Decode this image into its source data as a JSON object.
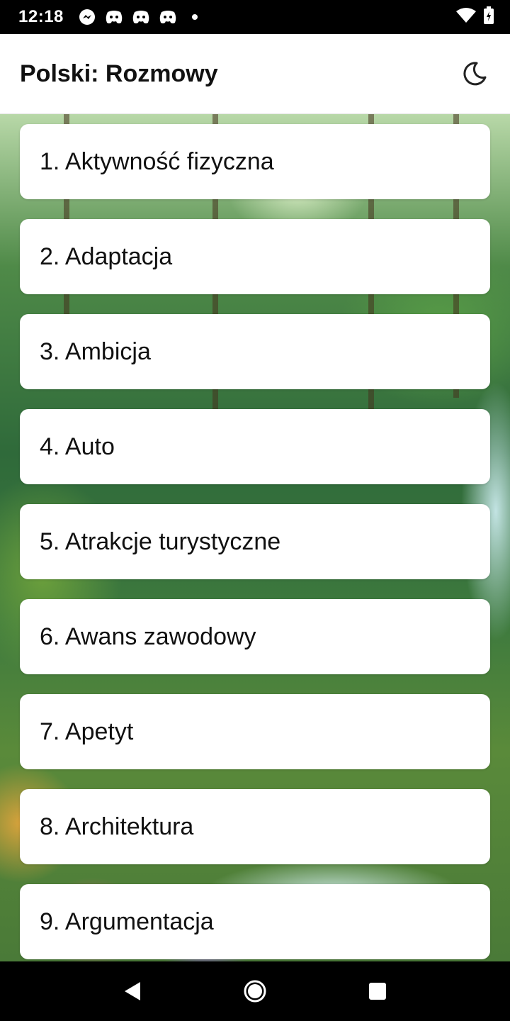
{
  "status_bar": {
    "time": "12:18",
    "left_icons": [
      "messenger-icon",
      "discord-icon",
      "discord-icon",
      "discord-icon",
      "dot-icon"
    ],
    "right_icons": [
      "wifi-icon",
      "battery-icon"
    ]
  },
  "app_bar": {
    "title": "Polski: Rozmowy",
    "theme_icon": "moon-icon"
  },
  "list": {
    "items": [
      {
        "label": "1. Aktywność fizyczna"
      },
      {
        "label": "2. Adaptacja"
      },
      {
        "label": "3. Ambicja"
      },
      {
        "label": "4. Auto"
      },
      {
        "label": "5. Atrakcje turystyczne"
      },
      {
        "label": "6. Awans zawodowy"
      },
      {
        "label": "7. Apetyt"
      },
      {
        "label": "8. Architektura"
      },
      {
        "label": "9. Argumentacja"
      }
    ]
  },
  "nav_bar": {
    "buttons": [
      "back-icon",
      "home-icon",
      "recents-icon"
    ]
  },
  "colors": {
    "app_bar_bg": "#ffffff",
    "card_bg": "#ffffff",
    "status_bar_bg": "#000000"
  }
}
